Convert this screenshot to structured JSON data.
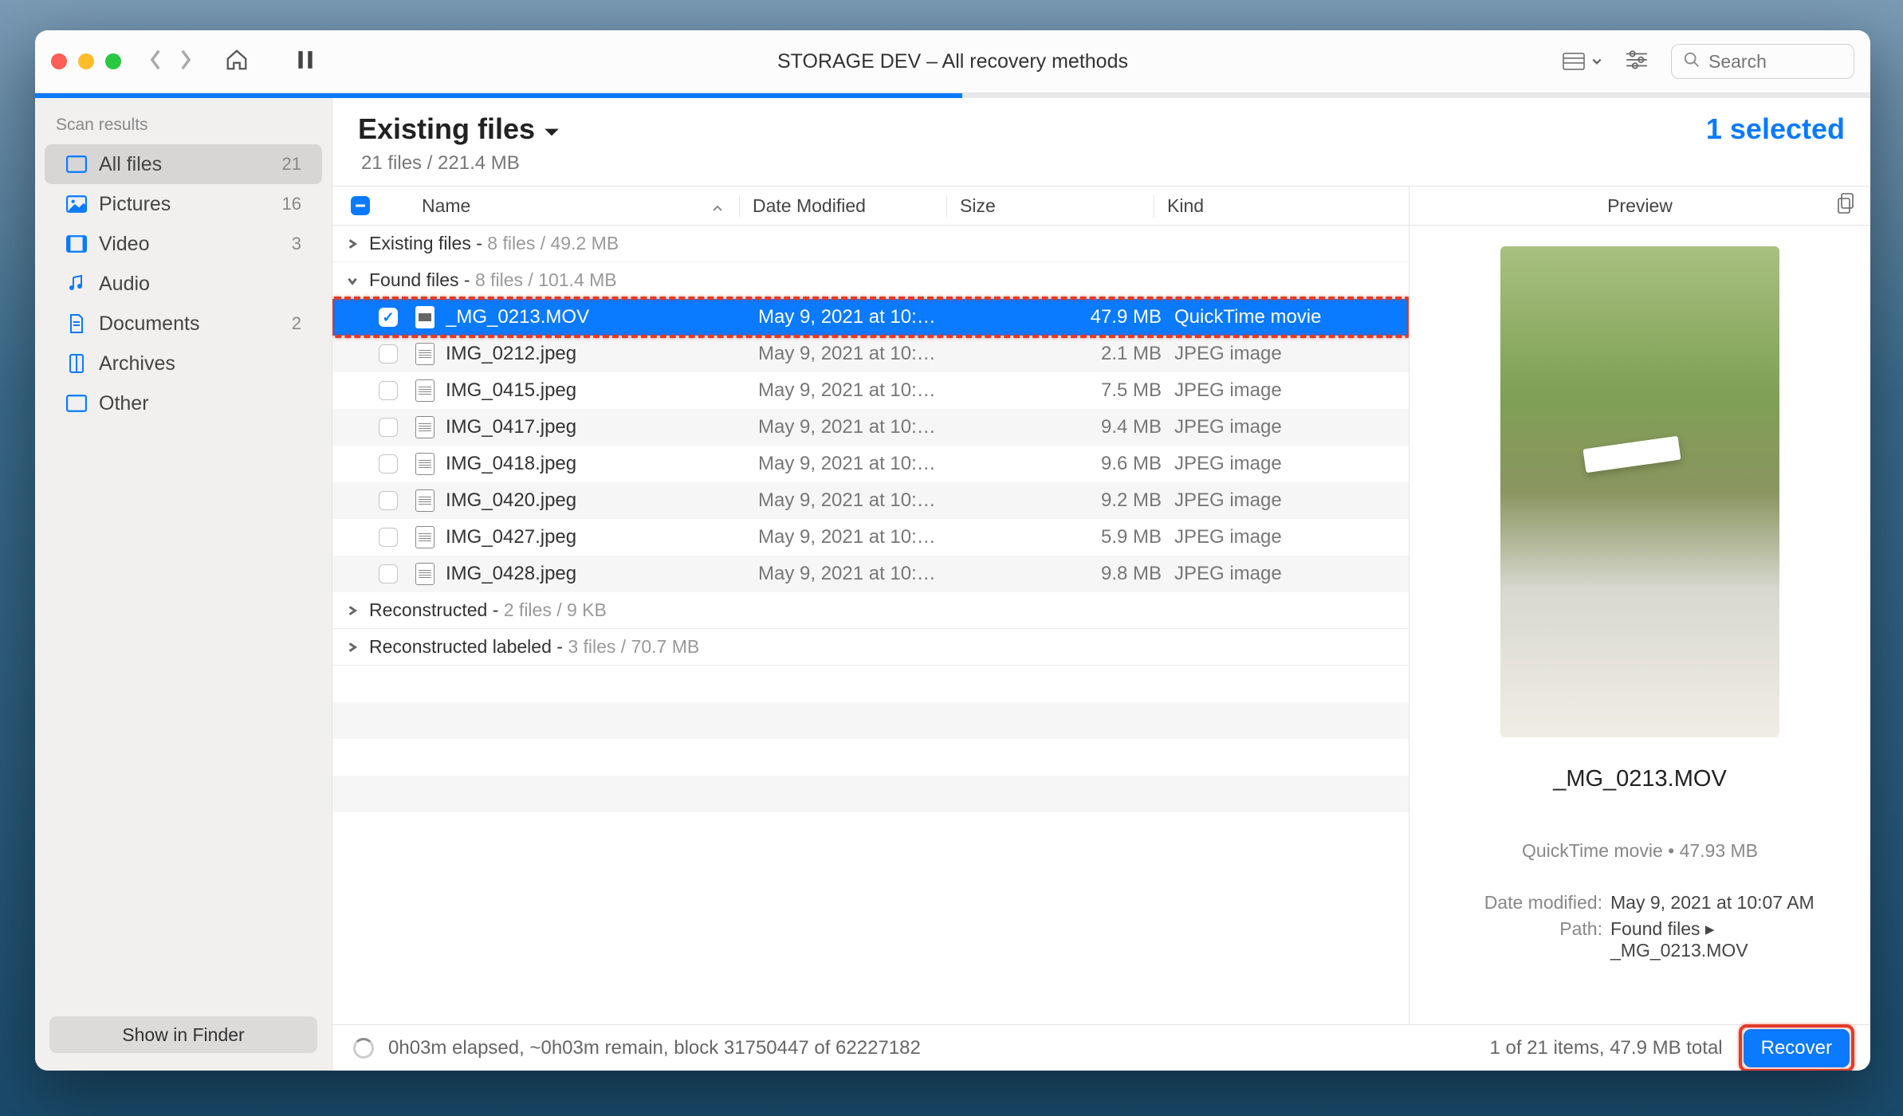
{
  "window_title": "STORAGE DEV – All recovery methods",
  "search_placeholder": "Search",
  "sidebar": {
    "title": "Scan results",
    "items": [
      {
        "label": "All files",
        "count": "21",
        "icon": "all"
      },
      {
        "label": "Pictures",
        "count": "16",
        "icon": "pic"
      },
      {
        "label": "Video",
        "count": "3",
        "icon": "vid"
      },
      {
        "label": "Audio",
        "count": "",
        "icon": "aud"
      },
      {
        "label": "Documents",
        "count": "2",
        "icon": "doc"
      },
      {
        "label": "Archives",
        "count": "",
        "icon": "arc"
      },
      {
        "label": "Other",
        "count": "",
        "icon": "oth"
      }
    ],
    "show_in_finder": "Show in Finder"
  },
  "main": {
    "title": "Existing files",
    "subtitle": "21 files / 221.4 MB",
    "selected": "1 selected"
  },
  "columns": {
    "name": "Name",
    "date": "Date Modified",
    "size": "Size",
    "kind": "Kind"
  },
  "groups": {
    "existing": {
      "label": "Existing files - ",
      "meta": "8 files / 49.2 MB"
    },
    "found": {
      "label": "Found files - ",
      "meta": "8 files / 101.4 MB"
    },
    "reconstructed": {
      "label": "Reconstructed - ",
      "meta": "2 files / 9 KB"
    },
    "reconstructed_labeled": {
      "label": "Reconstructed labeled - ",
      "meta": "3 files / 70.7 MB"
    }
  },
  "files": [
    {
      "name": "_MG_0213.MOV",
      "date": "May 9, 2021 at 10:…",
      "size": "47.9 MB",
      "kind": "QuickTime movie",
      "selected": true
    },
    {
      "name": "IMG_0212.jpeg",
      "date": "May 9, 2021 at 10:…",
      "size": "2.1 MB",
      "kind": "JPEG image"
    },
    {
      "name": "IMG_0415.jpeg",
      "date": "May 9, 2021 at 10:…",
      "size": "7.5 MB",
      "kind": "JPEG image"
    },
    {
      "name": "IMG_0417.jpeg",
      "date": "May 9, 2021 at 10:…",
      "size": "9.4 MB",
      "kind": "JPEG image"
    },
    {
      "name": "IMG_0418.jpeg",
      "date": "May 9, 2021 at 10:…",
      "size": "9.6 MB",
      "kind": "JPEG image"
    },
    {
      "name": "IMG_0420.jpeg",
      "date": "May 9, 2021 at 10:…",
      "size": "9.2 MB",
      "kind": "JPEG image"
    },
    {
      "name": "IMG_0427.jpeg",
      "date": "May 9, 2021 at 10:…",
      "size": "5.9 MB",
      "kind": "JPEG image"
    },
    {
      "name": "IMG_0428.jpeg",
      "date": "May 9, 2021 at 10:…",
      "size": "9.8 MB",
      "kind": "JPEG image"
    }
  ],
  "preview": {
    "title": "Preview",
    "filename": "_MG_0213.MOV",
    "meta": "QuickTime movie • 47.93 MB",
    "date_label": "Date modified:",
    "date_value": "May 9, 2021 at 10:07 AM",
    "path_label": "Path:",
    "path_value": "Found files ▸ _MG_0213.MOV"
  },
  "footer": {
    "status": "0h03m elapsed, ~0h03m remain, block 31750447 of 62227182",
    "summary": "1 of 21 items, 47.9 MB total",
    "recover": "Recover"
  },
  "progress_percent": 50.5
}
